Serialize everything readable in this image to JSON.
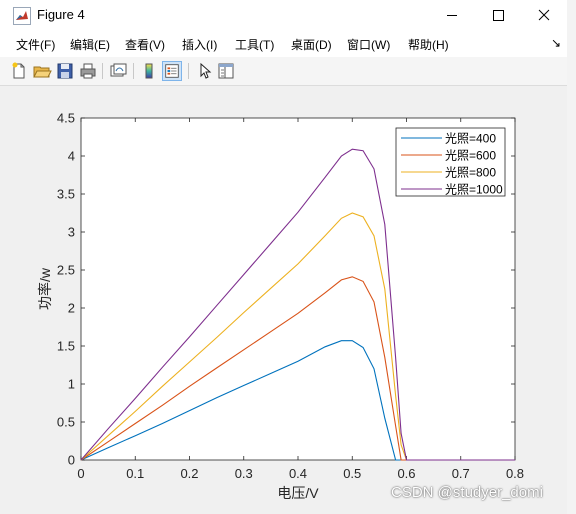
{
  "window": {
    "title": "Figure 4"
  },
  "menu": [
    {
      "label": "文件(F)"
    },
    {
      "label": "编辑(E)"
    },
    {
      "label": "查看(V)"
    },
    {
      "label": "插入(I)"
    },
    {
      "label": "工具(T)"
    },
    {
      "label": "桌面(D)"
    },
    {
      "label": "窗口(W)"
    },
    {
      "label": "帮助(H)"
    }
  ],
  "toolbar": {
    "icons": [
      "new-figure-icon",
      "open-file-icon",
      "save-icon",
      "print-icon",
      "link-plot-icon",
      "insert-colorbar-icon",
      "insert-legend-icon",
      "edit-plot-icon",
      "property-inspector-icon"
    ]
  },
  "chart_data": {
    "type": "line",
    "xlabel": "电压/V",
    "ylabel": "功率/w",
    "xlim": [
      0,
      0.8
    ],
    "ylim": [
      0,
      4.5
    ],
    "xticks": [
      "0",
      "0.1",
      "0.2",
      "0.3",
      "0.4",
      "0.5",
      "0.6",
      "0.7",
      "0.8"
    ],
    "yticks": [
      "0",
      "0.5",
      "1",
      "1.5",
      "2",
      "2.5",
      "3",
      "3.5",
      "4",
      "4.5"
    ],
    "grid": false,
    "legend_position": "top-right",
    "series": [
      {
        "name": "光照=400",
        "color": "#0072BD",
        "x": [
          0,
          0.05,
          0.1,
          0.15,
          0.2,
          0.25,
          0.3,
          0.35,
          0.4,
          0.45,
          0.48,
          0.5,
          0.52,
          0.54,
          0.56,
          0.58,
          0.6,
          0.8
        ],
        "y": [
          0,
          0.16,
          0.32,
          0.48,
          0.65,
          0.82,
          0.98,
          1.14,
          1.3,
          1.49,
          1.57,
          1.57,
          1.48,
          1.2,
          0.55,
          0,
          0,
          0
        ]
      },
      {
        "name": "光照=600",
        "color": "#D95319",
        "x": [
          0,
          0.05,
          0.1,
          0.15,
          0.2,
          0.25,
          0.3,
          0.35,
          0.4,
          0.45,
          0.48,
          0.5,
          0.52,
          0.54,
          0.56,
          0.58,
          0.59,
          0.6,
          0.8
        ],
        "y": [
          0,
          0.24,
          0.48,
          0.72,
          0.97,
          1.21,
          1.45,
          1.69,
          1.93,
          2.2,
          2.37,
          2.41,
          2.35,
          2.08,
          1.35,
          0.45,
          0,
          0,
          0
        ]
      },
      {
        "name": "光照=800",
        "color": "#EDB120",
        "x": [
          0,
          0.05,
          0.1,
          0.15,
          0.2,
          0.25,
          0.3,
          0.35,
          0.4,
          0.45,
          0.48,
          0.5,
          0.52,
          0.54,
          0.56,
          0.58,
          0.59,
          0.6,
          0.8
        ],
        "y": [
          0,
          0.32,
          0.64,
          0.97,
          1.29,
          1.61,
          1.94,
          2.26,
          2.58,
          2.95,
          3.18,
          3.25,
          3.2,
          2.95,
          2.25,
          0.85,
          0.2,
          0,
          0
        ]
      },
      {
        "name": "光照=1000",
        "color": "#7E2F8E",
        "x": [
          0,
          0.05,
          0.1,
          0.15,
          0.2,
          0.25,
          0.3,
          0.35,
          0.4,
          0.45,
          0.48,
          0.5,
          0.52,
          0.54,
          0.56,
          0.58,
          0.59,
          0.6,
          0.8
        ],
        "y": [
          0,
          0.41,
          0.81,
          1.22,
          1.62,
          2.03,
          2.44,
          2.85,
          3.26,
          3.72,
          4.0,
          4.09,
          4.07,
          3.83,
          3.1,
          1.35,
          0.35,
          0,
          0
        ]
      }
    ]
  },
  "watermark": "CSDN @studyer_domi"
}
